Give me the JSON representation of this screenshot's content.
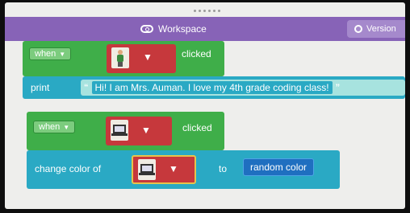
{
  "header": {
    "workspace_tab": "Workspace",
    "version_tab": "Version"
  },
  "blocks": [
    {
      "event_dropdown": "when",
      "sprite": "teacher-sprite",
      "event_label": "clicked",
      "action": "print",
      "text": "Hi! I am Mrs. Auman. I love my 4th grade coding class!"
    },
    {
      "event_dropdown": "when",
      "sprite": "laptop-sprite",
      "event_label": "clicked",
      "action": "change color of",
      "target_sprite": "laptop-sprite",
      "connector": "to",
      "color_value": "random color"
    }
  ],
  "colors": {
    "header": "#8763b7",
    "event_block": "#3fae49",
    "action_block": "#2aa9c4",
    "sprite_picker": "#c6383c",
    "color_value": "#1f6fc0"
  }
}
